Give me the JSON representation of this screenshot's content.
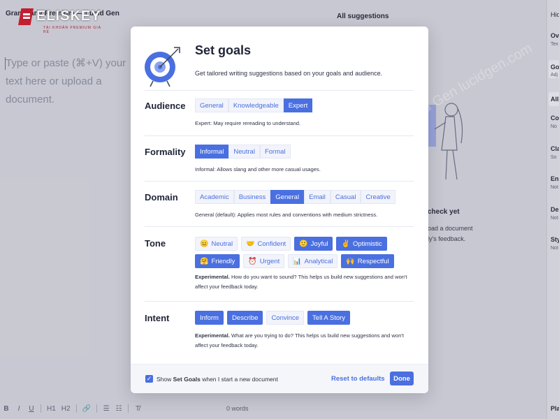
{
  "app": {
    "document_title": "Grammarly Premium — Lucid Gen",
    "brand_name": "ELISKEY",
    "brand_sub": "TÀI KHOẢN PREMIUM GIÁ RẺ",
    "editor_placeholder": "Type or paste (⌘+V) your text here or upload a document.",
    "suggestions_header": "All suggestions",
    "check_title": "check yet",
    "check_body_1": "oad a document",
    "check_body_2": "ly's feedback.",
    "word_count": "0 words",
    "right_panel": {
      "hide": "Hid",
      "overall": "Ov",
      "overall_sub": "Tex",
      "goals": "Go",
      "goals_sub": "Adj",
      "all": "All",
      "correctness": "Co",
      "correctness_sub": "No",
      "clarity": "Cla",
      "clarity_sub": "So",
      "engagement": "Eng",
      "engagement_sub": "Not",
      "delivery": "Del",
      "delivery_sub": "Not",
      "style": "Sty",
      "style_sub": "Not",
      "plagiarism": "Pla"
    },
    "toolbar": [
      "B",
      "I",
      "U",
      "H1",
      "H2",
      "🔗",
      "☰",
      "☷",
      "T̸"
    ],
    "watermark": "Lucid Gen    lucidgen.com"
  },
  "modal": {
    "title": "Set goals",
    "subtitle": "Get tailored writing suggestions based on your goals and audience.",
    "sections": {
      "audience": {
        "label": "Audience",
        "options": [
          "General",
          "Knowledgeable",
          "Expert"
        ],
        "selected": "Expert",
        "desc_label": "Expert:",
        "desc": "May require rereading to understand."
      },
      "formality": {
        "label": "Formality",
        "options": [
          "Informal",
          "Neutral",
          "Formal"
        ],
        "selected": "Informal",
        "desc_label": "Informal:",
        "desc": "Allows slang and other more casual usages."
      },
      "domain": {
        "label": "Domain",
        "options": [
          "Academic",
          "Business",
          "General",
          "Email",
          "Casual",
          "Creative"
        ],
        "selected": "General",
        "desc_label": "General (default):",
        "desc": "Applies most rules and conventions with medium strictness."
      },
      "tone": {
        "label": "Tone",
        "options": [
          {
            "label": "Neutral",
            "emoji": "😐",
            "selected": false
          },
          {
            "label": "Confident",
            "emoji": "🤝",
            "selected": false
          },
          {
            "label": "Joyful",
            "emoji": "🙂",
            "selected": true
          },
          {
            "label": "Optimistic",
            "emoji": "✌",
            "selected": true
          },
          {
            "label": "Friendly",
            "emoji": "🤗",
            "selected": true
          },
          {
            "label": "Urgent",
            "emoji": "⏰",
            "selected": false
          },
          {
            "label": "Analytical",
            "emoji": "📊",
            "selected": false
          },
          {
            "label": "Respectful",
            "emoji": "🙌",
            "selected": true
          }
        ],
        "desc_label": "Experimental.",
        "desc": "How do you want to sound? This helps us build new suggestions and won't affect your feedback today."
      },
      "intent": {
        "label": "Intent",
        "options": [
          {
            "label": "Inform",
            "selected": true
          },
          {
            "label": "Describe",
            "selected": true
          },
          {
            "label": "Convince",
            "selected": false
          },
          {
            "label": "Tell A Story",
            "selected": true
          }
        ],
        "desc_label": "Experimental.",
        "desc": "What are you trying to do? This helps us build new suggestions and won't affect your feedback today."
      }
    },
    "footer": {
      "checkbox_checked": true,
      "checkbox_label_pre": "Show ",
      "checkbox_label_bold": "Set Goals",
      "checkbox_label_post": " when I start a new document",
      "reset_label": "Reset to defaults",
      "done_label": "Done"
    }
  },
  "colors": {
    "accent": "#4a6fe0",
    "chip_bg": "#f2f4fb",
    "backdrop": "#cfd0d8",
    "brand_red": "#c8202f"
  }
}
